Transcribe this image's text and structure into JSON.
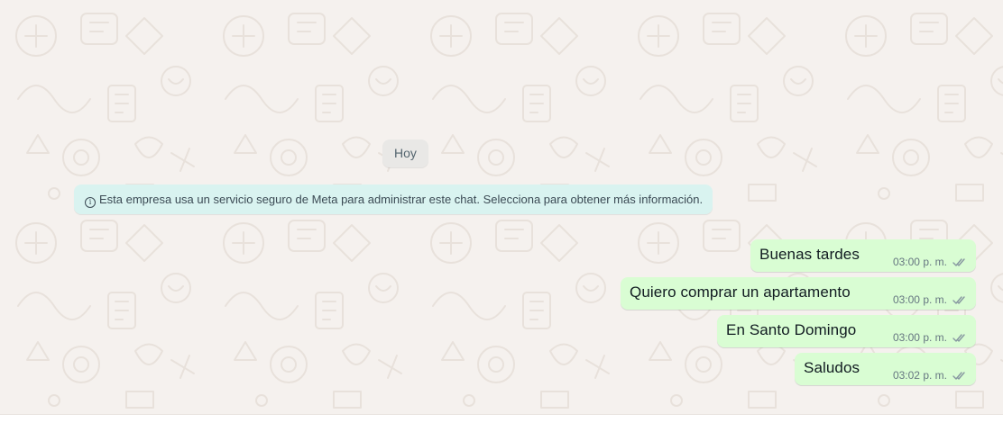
{
  "date_divider": "Hoy",
  "system_notice": {
    "icon": "info-icon",
    "text": "Esta empresa usa un servicio seguro de Meta para administrar este chat. Selecciona para obtener más información."
  },
  "messages": [
    {
      "text": "Buenas tardes",
      "time": "03:00 p. m.",
      "status_icon": "double-check-icon"
    },
    {
      "text": "Quiero comprar un apartamento",
      "time": "03:00 p. m.",
      "status_icon": "double-check-icon"
    },
    {
      "text": "En Santo Domingo",
      "time": "03:00 p. m.",
      "status_icon": "double-check-icon"
    },
    {
      "text": "Saludos",
      "time": "03:02 p. m.",
      "status_icon": "double-check-icon"
    }
  ],
  "colors": {
    "chat_background": "#f5f1ee",
    "outgoing_bubble": "#d9fdd3",
    "notice_background": "#d9f3f0",
    "date_chip": "#e9e8e6"
  }
}
